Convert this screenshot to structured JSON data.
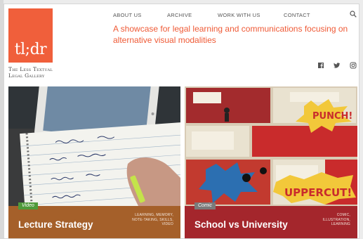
{
  "brand": {
    "logo_text": "tl;dr",
    "name_line1": "The Less Textual",
    "name_line2": "Legal Gallery",
    "accent_color": "#f05f3b"
  },
  "nav": {
    "items": [
      {
        "label": "ABOUT US"
      },
      {
        "label": "ARCHIVE"
      },
      {
        "label": "WORK WITH US"
      },
      {
        "label": "CONTACT"
      }
    ],
    "search_icon": "search-icon"
  },
  "tagline": "A showcase for legal learning and communications focusing on alternative visual modalities",
  "social": [
    {
      "icon": "facebook-icon"
    },
    {
      "icon": "twitter-icon"
    },
    {
      "icon": "instagram-icon"
    }
  ],
  "cards": [
    {
      "title": "Lecture Strategy",
      "badge": "Video",
      "tags": [
        "Learning, Memory,",
        "Note-taking, Skills,",
        "Video"
      ],
      "bar_color": "#a5602a"
    },
    {
      "title": "School vs University",
      "badge": "Comic",
      "tags": [
        "Comic,",
        "Illustration,",
        "Learning"
      ],
      "bar_color": "#a4262c"
    }
  ]
}
